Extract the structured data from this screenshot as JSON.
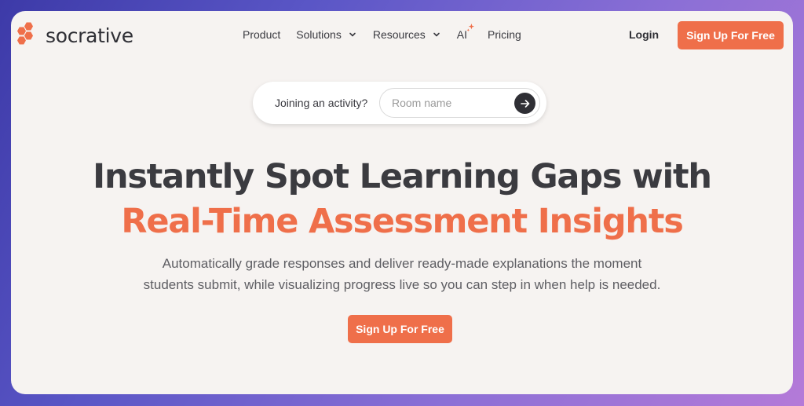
{
  "brand": {
    "name": "socrative",
    "accent_color": "#ef6f4a"
  },
  "nav": {
    "items": [
      {
        "label": "Product",
        "icon": ""
      },
      {
        "label": "Solutions",
        "icon": "chevron-down-icon"
      },
      {
        "label": "Resources",
        "icon": "chevron-down-icon"
      },
      {
        "label": "AI",
        "icon": "sparkle-icon"
      },
      {
        "label": "Pricing",
        "icon": ""
      }
    ],
    "login_label": "Login",
    "signup_label": "Sign Up For Free"
  },
  "join": {
    "label": "Joining an activity?",
    "placeholder": "Room name",
    "value": "",
    "submit_icon": "arrow-right-icon"
  },
  "hero": {
    "headline_line1": "Instantly Spot Learning Gaps with",
    "headline_line2": "Real-Time Assessment Insights",
    "subtext_line1": "Automatically grade responses and deliver ready-made explanations the moment",
    "subtext_line2": "students submit, while visualizing progress live so you can step in when help is needed.",
    "cta_label": "Sign Up For Free"
  }
}
